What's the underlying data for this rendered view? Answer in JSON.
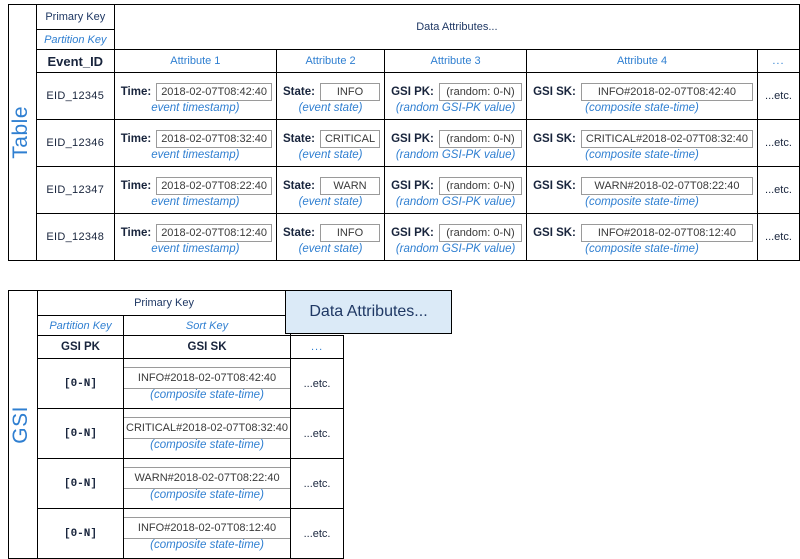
{
  "diagram": {
    "accent_blue": "#2f7fd1",
    "header_blue_bg": "#dbeaf7",
    "header_text": "#1f3864"
  },
  "table1": {
    "side_label": "Table",
    "primary_key_label": "Primary Key",
    "partition_key_label": "Partition Key",
    "data_attributes_label": "Data Attributes...",
    "columns": {
      "key": "Event_ID",
      "attr1": "Attribute 1",
      "attr2": "Attribute 2",
      "attr3": "Attribute 3",
      "attr4": "Attribute 4",
      "more": "..."
    },
    "captions": {
      "time": "event timestamp)",
      "state": "(event state)",
      "gsipk": "(random GSI-PK value)",
      "gsisk": "(composite state-time)"
    },
    "field_labels": {
      "time": "Time:",
      "state": "State:",
      "gsipk": "GSI PK:",
      "gsisk": "GSI SK:"
    },
    "etc_label": "...etc.",
    "rows": [
      {
        "event_id": "EID_12345",
        "time": "2018-02-07T08:42:40",
        "state": "INFO",
        "gsi_pk": "(random: 0-N)",
        "gsi_sk": "INFO#2018-02-07T08:42:40"
      },
      {
        "event_id": "EID_12346",
        "time": "2018-02-07T08:32:40",
        "state": "CRITICAL",
        "gsi_pk": "(random: 0-N)",
        "gsi_sk": "CRITICAL#2018-02-07T08:32:40"
      },
      {
        "event_id": "EID_12347",
        "time": "2018-02-07T08:22:40",
        "state": "WARN",
        "gsi_pk": "(random: 0-N)",
        "gsi_sk": "WARN#2018-02-07T08:22:40"
      },
      {
        "event_id": "EID_12348",
        "time": "2018-02-07T08:12:40",
        "state": "INFO",
        "gsi_pk": "(random: 0-N)",
        "gsi_sk": "INFO#2018-02-07T08:12:40"
      }
    ]
  },
  "table2": {
    "side_label": "GSI",
    "primary_key_label": "Primary Key",
    "partition_key_label": "Partition Key",
    "sort_key_label": "Sort Key",
    "data_attributes_label": "Data Attributes...",
    "columns": {
      "gsi_pk": "GSI PK",
      "gsi_sk": "GSI SK",
      "more": "..."
    },
    "caption": "(composite state-time)",
    "etc_label": "...etc.",
    "rows": [
      {
        "gsi_pk": "[0-N]",
        "gsi_sk": "INFO#2018-02-07T08:42:40"
      },
      {
        "gsi_pk": "[0-N]",
        "gsi_sk": "CRITICAL#2018-02-07T08:32:40"
      },
      {
        "gsi_pk": "[0-N]",
        "gsi_sk": "WARN#2018-02-07T08:22:40"
      },
      {
        "gsi_pk": "[0-N]",
        "gsi_sk": "INFO#2018-02-07T08:12:40"
      }
    ]
  }
}
